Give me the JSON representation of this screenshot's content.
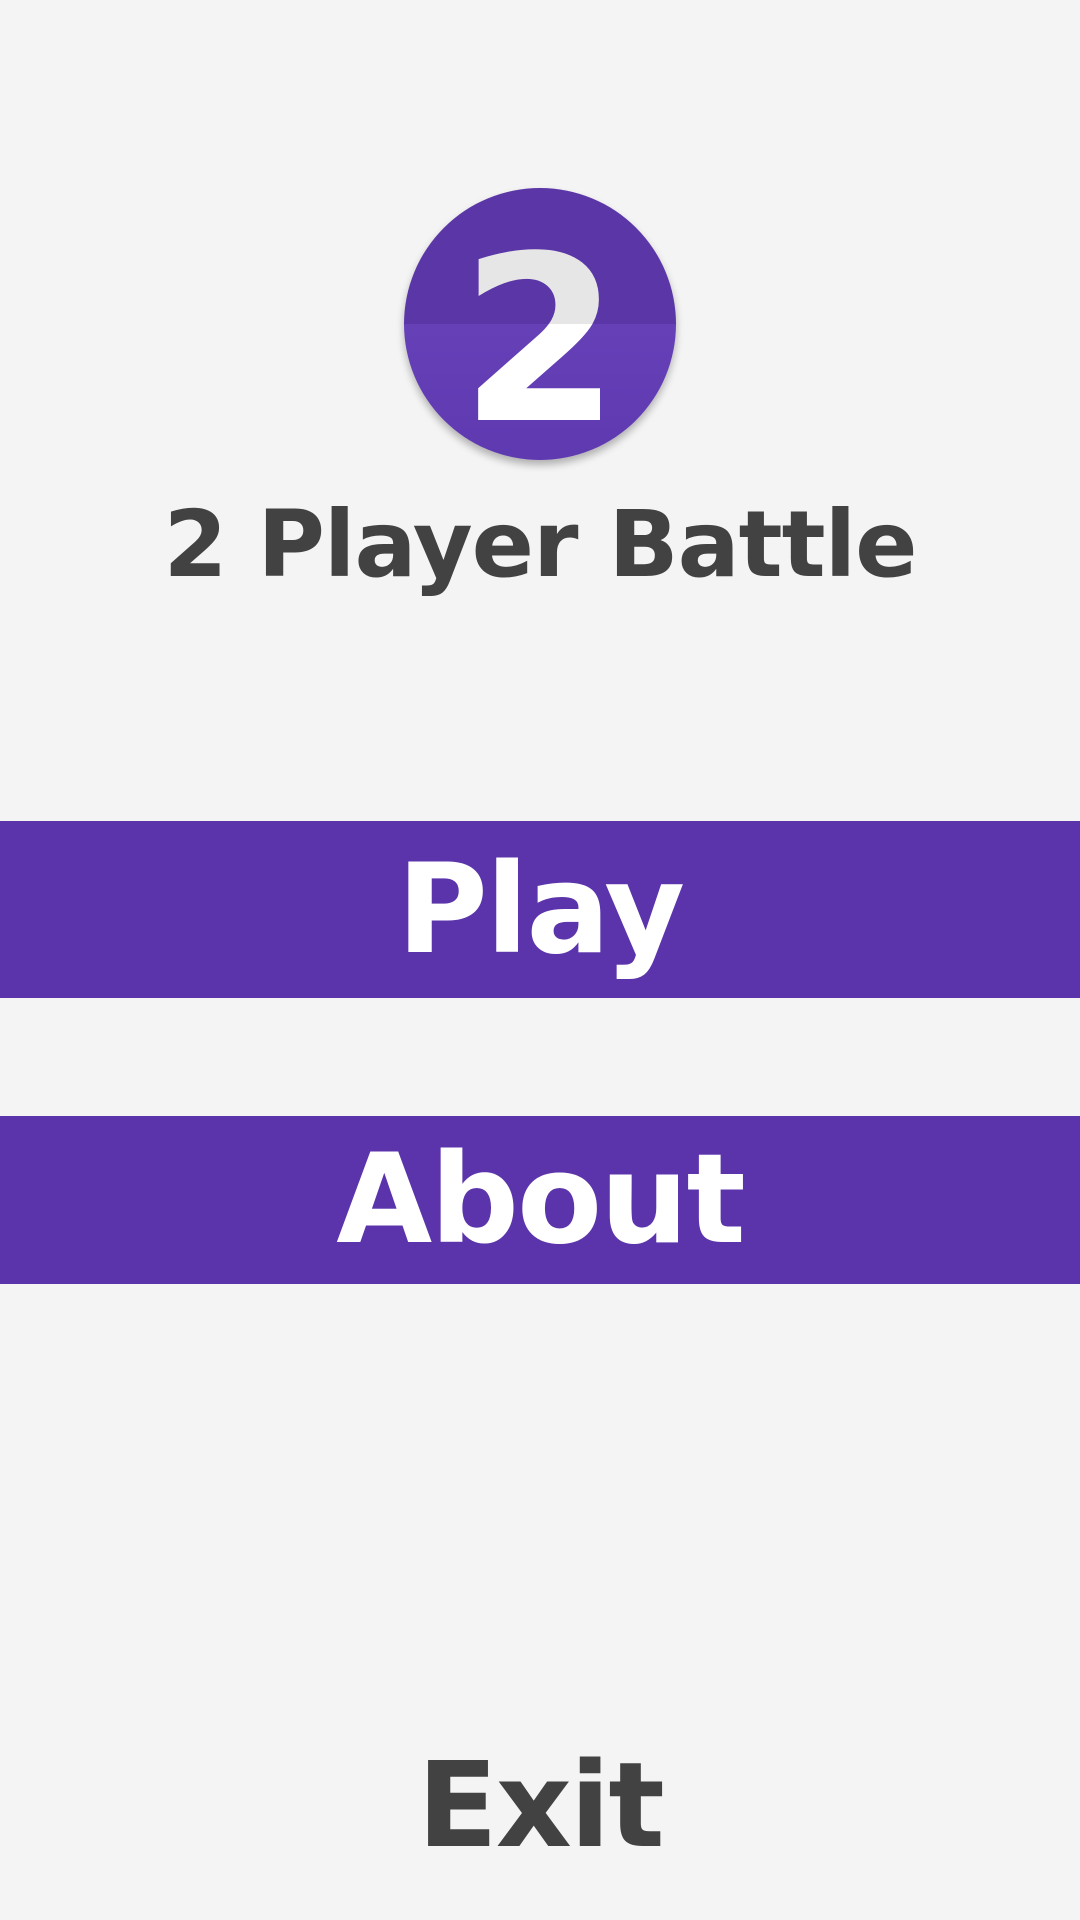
{
  "logo": {
    "digit": "2"
  },
  "title": "2 Player Battle",
  "menu": {
    "play_label": "Play",
    "about_label": "About",
    "exit_label": "Exit"
  },
  "colors": {
    "background": "#f4f4f4",
    "accent": "#5b34ac",
    "text_dark": "#424242",
    "button_text": "#ffffff"
  }
}
